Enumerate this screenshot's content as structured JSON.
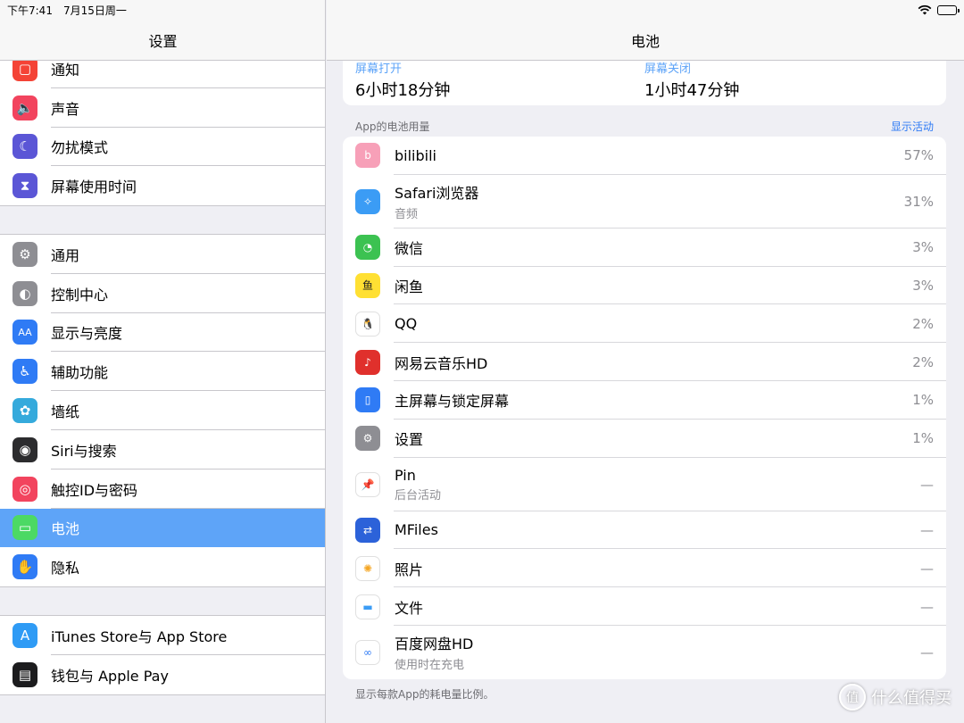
{
  "status_bar": {
    "time": "下午7:41",
    "date": "7月15日周一"
  },
  "sidebar": {
    "title": "设置",
    "group1": [
      {
        "label": "通知",
        "icon": "notification-icon",
        "color": "#f44336"
      },
      {
        "label": "声音",
        "icon": "speaker-icon",
        "color": "#f2445e"
      },
      {
        "label": "勿扰模式",
        "icon": "moon-icon",
        "color": "#5b56d6"
      },
      {
        "label": "屏幕使用时间",
        "icon": "hourglass-icon",
        "color": "#5b56d6"
      }
    ],
    "group2": [
      {
        "label": "通用",
        "icon": "gear-icon",
        "color": "#8e8e93"
      },
      {
        "label": "控制中心",
        "icon": "toggles-icon",
        "color": "#8e8e93"
      },
      {
        "label": "显示与亮度",
        "icon": "text-size-icon",
        "color": "#2f7bf5"
      },
      {
        "label": "辅助功能",
        "icon": "accessibility-icon",
        "color": "#2f7bf5"
      },
      {
        "label": "墙纸",
        "icon": "flower-icon",
        "color": "#35aadc"
      },
      {
        "label": "Siri与搜索",
        "icon": "siri-icon",
        "color": "#2c2c2e"
      },
      {
        "label": "触控ID与密码",
        "icon": "fingerprint-icon",
        "color": "#f2445e"
      },
      {
        "label": "电池",
        "icon": "battery-icon",
        "color": "#4cd964",
        "selected": true
      },
      {
        "label": "隐私",
        "icon": "hand-icon",
        "color": "#2f7bf5"
      }
    ],
    "group3": [
      {
        "label": "iTunes Store与 App Store",
        "icon": "app-store-icon",
        "color": "#2f9bf5"
      },
      {
        "label": "钱包与 Apple Pay",
        "icon": "wallet-icon",
        "color": "#1c1c1e"
      }
    ]
  },
  "main": {
    "title": "电池",
    "screen_on_label": "屏幕打开",
    "screen_on_value": "6小时18分钟",
    "screen_off_label": "屏幕关闭",
    "screen_off_value": "1小时47分钟",
    "section_label": "App的电池用量",
    "show_activity": "显示活动",
    "apps": [
      {
        "name": "bilibili",
        "sub": "",
        "pct": "57%",
        "icon": "bilibili-icon",
        "color": "#f7a0b8"
      },
      {
        "name": "Safari浏览器",
        "sub": "音频",
        "pct": "31%",
        "icon": "compass-icon",
        "color": "#3b9cf5"
      },
      {
        "name": "微信",
        "sub": "",
        "pct": "3%",
        "icon": "wechat-icon",
        "color": "#3cc251"
      },
      {
        "name": "闲鱼",
        "sub": "",
        "pct": "3%",
        "icon": "xianyu-icon",
        "color": "#ffe033"
      },
      {
        "name": "QQ",
        "sub": "",
        "pct": "2%",
        "icon": "penguin-icon",
        "color": "#ffffff"
      },
      {
        "name": "网易云音乐HD",
        "sub": "",
        "pct": "2%",
        "icon": "netease-music-icon",
        "color": "#e0302c"
      },
      {
        "name": "主屏幕与锁定屏幕",
        "sub": "",
        "pct": "1%",
        "icon": "ipad-icon",
        "color": "#2f7bf5"
      },
      {
        "name": "设置",
        "sub": "",
        "pct": "1%",
        "icon": "gear-icon",
        "color": "#8e8e93"
      },
      {
        "name": "Pin",
        "sub": "后台活动",
        "pct": "—",
        "icon": "pin-icon",
        "color": "#ffffff"
      },
      {
        "name": "MFiles",
        "sub": "",
        "pct": "—",
        "icon": "transfer-icon",
        "color": "#2c62d9"
      },
      {
        "name": "照片",
        "sub": "",
        "pct": "—",
        "icon": "photos-icon",
        "color": "#ffffff"
      },
      {
        "name": "文件",
        "sub": "",
        "pct": "—",
        "icon": "folder-icon",
        "color": "#ffffff"
      },
      {
        "name": "百度网盘HD",
        "sub": "使用时在充电",
        "pct": "—",
        "icon": "baidu-cloud-icon",
        "color": "#ffffff"
      }
    ],
    "footnote": "显示每款App的耗电量比例。"
  },
  "watermark": {
    "badge": "值",
    "text": "什么值得买"
  }
}
